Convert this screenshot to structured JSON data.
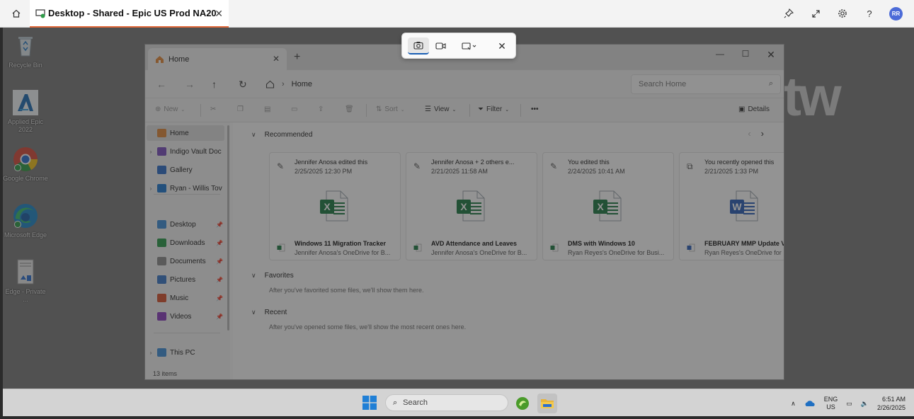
{
  "host": {
    "tab_title": "Desktop - Shared - Epic US Prod NA20",
    "avatar_initials": "RR",
    "actions": [
      "pin-icon",
      "expand-icon",
      "gear-icon",
      "help-icon"
    ],
    "help_glyph": "?"
  },
  "snip_toolbar": {
    "modes": [
      "camera-icon",
      "video-icon"
    ],
    "shape": "rectangle-snip-icon",
    "active_mode": "camera-icon"
  },
  "desktop": {
    "watermark": "tw",
    "icons": [
      {
        "label": "Recycle Bin",
        "icon": "recycle-bin-icon"
      },
      {
        "label": "Applied Epic 2022",
        "icon": "applied-epic-icon"
      },
      {
        "label": "Google Chrome",
        "icon": "chrome-icon"
      },
      {
        "label": "Microsoft Edge",
        "icon": "edge-icon"
      },
      {
        "label": "Edge - Private ...",
        "icon": "edge-private-icon"
      }
    ]
  },
  "explorer": {
    "tab_label": "Home",
    "breadcrumb": "Home",
    "search_placeholder": "Search Home",
    "commands": {
      "new": "New",
      "sort": "Sort",
      "view": "View",
      "filter": "Filter",
      "more": "•••",
      "details": "Details"
    },
    "nav": [
      {
        "label": "Home",
        "color": "#e0883a",
        "selected": true,
        "chevron": false,
        "pinned": false
      },
      {
        "label": "Indigo Vault Doc",
        "color": "#7a4fbf",
        "selected": false,
        "chevron": true,
        "pinned": false
      },
      {
        "label": "Gallery",
        "color": "#2f6fc9",
        "selected": false,
        "chevron": false,
        "pinned": false
      },
      {
        "label": "Ryan - Willis Tov",
        "color": "#1f78d1",
        "selected": false,
        "chevron": true,
        "pinned": false
      },
      {
        "label": "Desktop",
        "color": "#3f8fd8",
        "selected": false,
        "chevron": false,
        "pinned": true
      },
      {
        "label": "Downloads",
        "color": "#2b9a4a",
        "selected": false,
        "chevron": false,
        "pinned": true
      },
      {
        "label": "Documents",
        "color": "#8c8c8c",
        "selected": false,
        "chevron": false,
        "pinned": true
      },
      {
        "label": "Pictures",
        "color": "#3a79c9",
        "selected": false,
        "chevron": false,
        "pinned": true
      },
      {
        "label": "Music",
        "color": "#d6532f",
        "selected": false,
        "chevron": false,
        "pinned": true
      },
      {
        "label": "Videos",
        "color": "#8a3fbf",
        "selected": false,
        "chevron": false,
        "pinned": true
      },
      {
        "label": "This PC",
        "color": "#3f8fd8",
        "selected": false,
        "chevron": true,
        "pinned": false
      }
    ],
    "status": "13 items",
    "sections": {
      "recommended": "Recommended",
      "favorites": "Favorites",
      "favorites_note": "After you've favorited some files, we'll show them here.",
      "recent": "Recent",
      "recent_note": "After you've opened some files, we'll show the most recent ones here."
    },
    "cards": [
      {
        "activity": "Jennifer Anosa edited this",
        "when": "2/25/2025 12:30 PM",
        "file": "Windows 11 Migration Tracker",
        "location": "Jennifer Anosa's OneDrive for B...",
        "type": "excel",
        "activity_icon": "pencil-icon"
      },
      {
        "activity": "Jennifer Anosa + 2 others e...",
        "when": "2/21/2025 11:58 AM",
        "file": "AVD Attendance and Leaves",
        "location": "Jennifer Anosa's OneDrive for B...",
        "type": "excel",
        "activity_icon": "pencil-icon"
      },
      {
        "activity": "You edited this",
        "when": "2/24/2025 10:41 AM",
        "file": "DMS with Windows 10",
        "location": "Ryan Reyes's OneDrive for Busi...",
        "type": "excel",
        "activity_icon": "pencil-icon"
      },
      {
        "activity": "You recently opened this",
        "when": "2/21/2025 1:33 PM",
        "file": "FEBRUARY MMP Update V",
        "location": "Ryan Reyes's OneDrive for",
        "type": "word",
        "activity_icon": "open-external-icon"
      }
    ],
    "colors": {
      "excel": "#1f7a44",
      "word": "#2b5fb8"
    }
  },
  "taskbar": {
    "search_label": "Search",
    "lang": "ENG",
    "region": "US",
    "time": "6:51 AM",
    "date": "2/26/2025"
  }
}
